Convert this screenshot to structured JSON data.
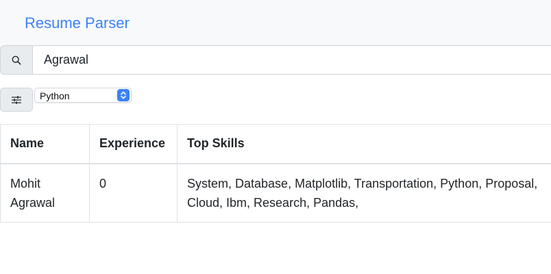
{
  "navbar": {
    "brand": "Resume Parser"
  },
  "search": {
    "icon": "search-icon",
    "value": "Agrawal"
  },
  "filter": {
    "icon": "sliders-icon",
    "selected": "Python"
  },
  "table": {
    "headers": [
      "Name",
      "Experience",
      "Top Skills"
    ],
    "rows": [
      {
        "name_line1": "Mohit",
        "name_line2": "Agrawal",
        "experience": "0",
        "skills_line1": "System, Database, Matplotlib, Transportation, Python, Proposal,",
        "skills_line2": "Cloud, Ibm, Research, Pandas,"
      }
    ]
  },
  "colors": {
    "brand": "#3b82f6",
    "navbar_bg": "#f8f9fa",
    "addon_bg": "#e9ecef"
  }
}
